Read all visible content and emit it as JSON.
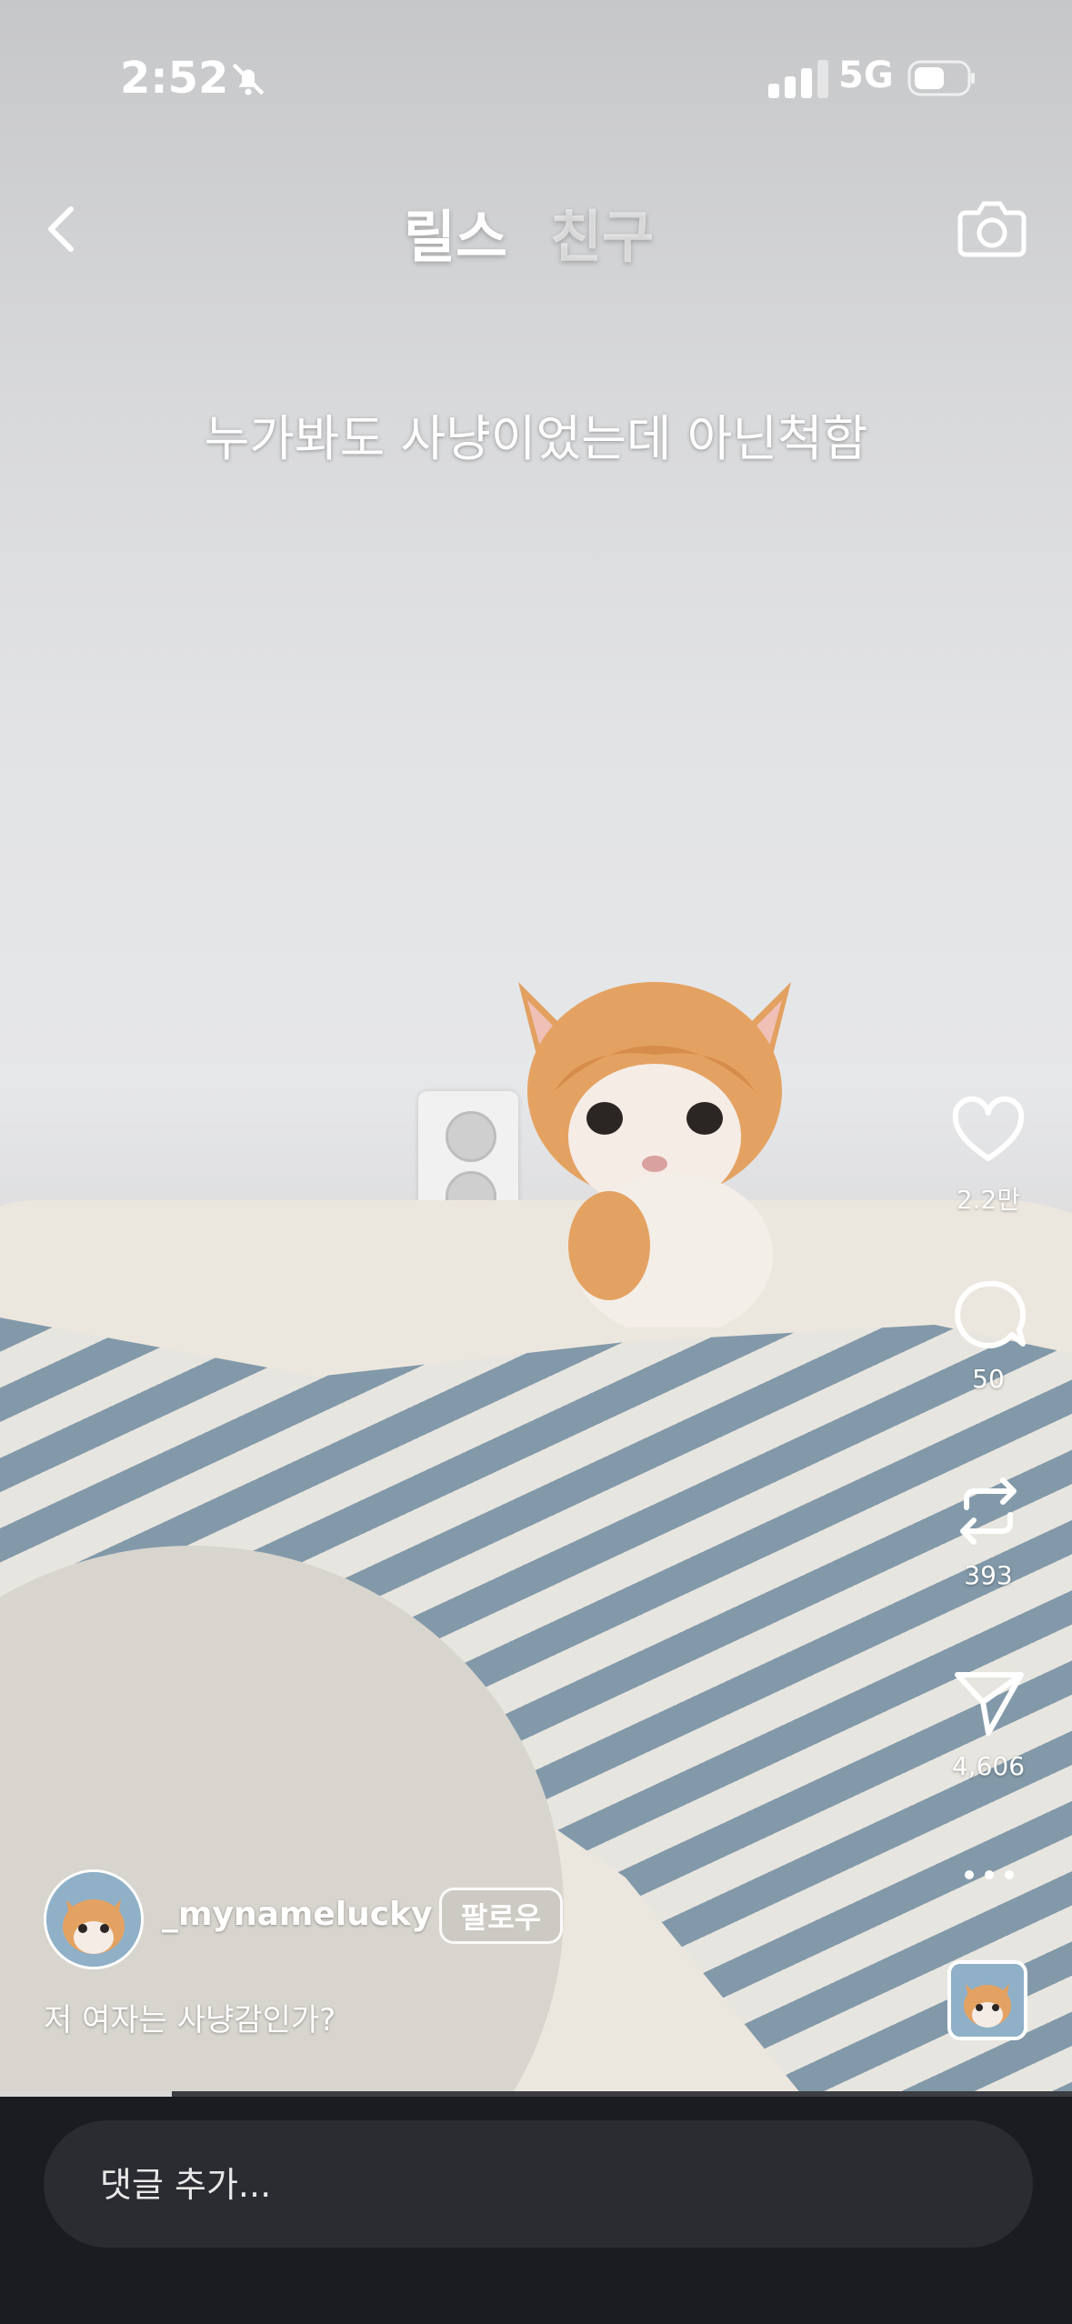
{
  "status_bar": {
    "time": "2:52",
    "network": "5G",
    "icons": [
      "bell-slash-icon",
      "signal-icon",
      "battery-icon"
    ]
  },
  "header": {
    "tabs": [
      {
        "label": "릴스",
        "active": true
      },
      {
        "label": "친구",
        "active": false
      }
    ],
    "icons": [
      "back-icon",
      "camera-icon"
    ]
  },
  "video": {
    "overlay_text": "누가봐도 사냥이었는데 아닌척함"
  },
  "actions": {
    "like": {
      "icon": "heart-icon",
      "count": "2.2만"
    },
    "comment": {
      "icon": "comment-icon",
      "count": "50"
    },
    "repost": {
      "icon": "repost-icon",
      "count": "393"
    },
    "share": {
      "icon": "send-icon",
      "count": "4,606"
    },
    "more": {
      "icon": "more-icon"
    }
  },
  "post": {
    "username": "_mynamelucky",
    "follow_label": "팔로우",
    "caption": "저 여자는 사냥감인가?"
  },
  "playback": {
    "progress_fraction": 0.16
  },
  "comment_bar": {
    "placeholder": "댓글 추가..."
  },
  "colors": {
    "background": "#1b1c20",
    "input": "#2b2c31"
  }
}
